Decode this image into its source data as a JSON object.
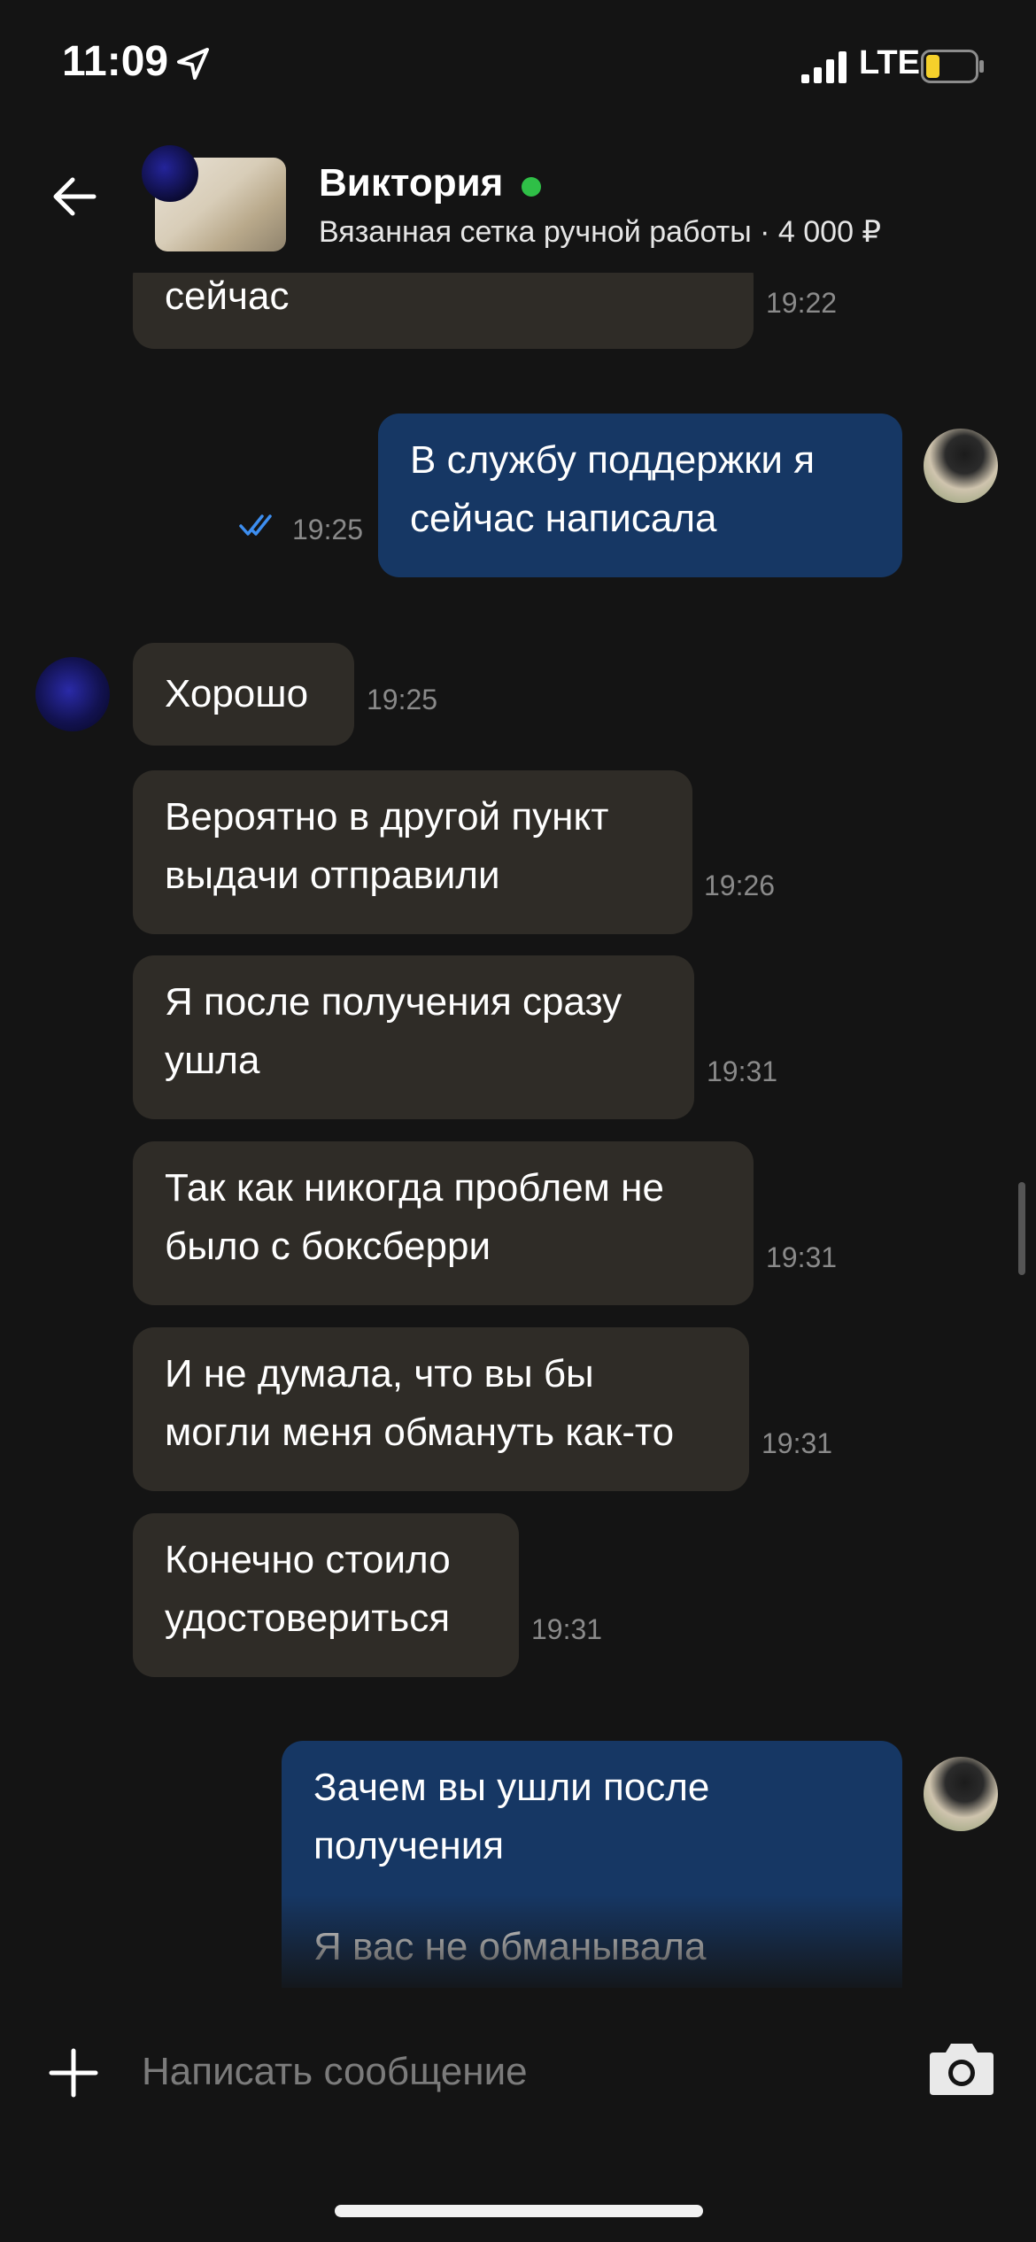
{
  "status_bar": {
    "time": "11:09",
    "network": "LTE",
    "battery_color": "#f5d02b"
  },
  "header": {
    "contact_name": "Виктория",
    "online": true,
    "product": "Вязанная сетка ручной работы · 4 000 ₽"
  },
  "messages": [
    {
      "dir": "in",
      "lines": [
        "сейчас"
      ],
      "time": "19:22"
    },
    {
      "dir": "out",
      "lines": [
        "В службу поддержки я",
        "сейчас написала"
      ],
      "time": "19:25",
      "read": true
    },
    {
      "dir": "in",
      "lines": [
        "Хорошо"
      ],
      "time": "19:25"
    },
    {
      "dir": "in",
      "lines": [
        "Вероятно в другой пункт",
        "выдачи отправили"
      ],
      "time": "19:26"
    },
    {
      "dir": "in",
      "lines": [
        "Я после получения сразу",
        "ушла"
      ],
      "time": "19:31"
    },
    {
      "dir": "in",
      "lines": [
        "Так как никогда проблем не",
        "было с боксберри"
      ],
      "time": "19:31"
    },
    {
      "dir": "in",
      "lines": [
        "И не думала, что вы бы",
        "могли меня обмануть как-то"
      ],
      "time": "19:31"
    },
    {
      "dir": "in",
      "lines": [
        "Конечно стоило",
        "удостовериться"
      ],
      "time": "19:31"
    },
    {
      "dir": "out",
      "lines": [
        "Зачем вы ушли после",
        "получения",
        "",
        "Я вас не обманывала"
      ],
      "time": ""
    }
  ],
  "composer": {
    "placeholder": "Написать сообщение"
  },
  "colors": {
    "bubble_in": "#2f2c27",
    "bubble_out": "#163764",
    "ticks": "#3d8ef0",
    "online": "#2fbf47"
  },
  "icons": [
    "location-arrow-icon",
    "signal-icon",
    "battery-icon",
    "back-arrow-icon",
    "plus-icon",
    "camera-icon",
    "double-check-icon"
  ]
}
